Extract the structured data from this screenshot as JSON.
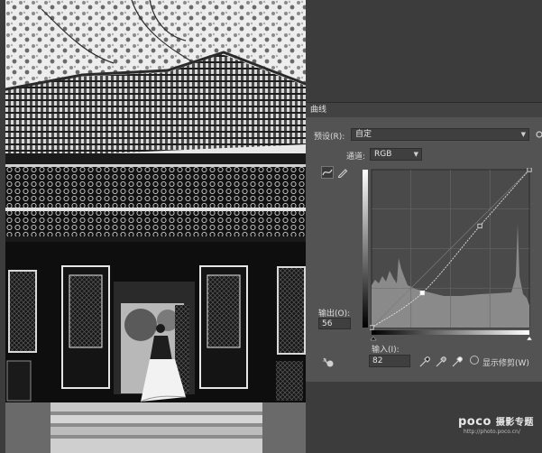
{
  "dialog": {
    "title": "曲线",
    "preset_label": "预设(R):",
    "preset_value": "自定",
    "channel_label": "通道:",
    "channel_value": "RGB",
    "output_label": "输出(O):",
    "output_value": "56",
    "input_label": "输入(I):",
    "input_value": "82",
    "show_clipping_label": "显示修剪(W)",
    "show_clipping_checked": false
  },
  "curve": {
    "points": [
      [
        0,
        0
      ],
      [
        82,
        56
      ],
      [
        175,
        164
      ],
      [
        255,
        255
      ]
    ]
  },
  "icons": [
    "curve-tool-icon",
    "pencil-tool-icon",
    "target-adjust-icon",
    "black-eyedropper-icon",
    "gray-eyedropper-icon",
    "white-eyedropper-icon",
    "settings-icon"
  ],
  "watermark": {
    "brand": "poco",
    "brand_suffix": "摄影专题",
    "url": "http://photo.poco.cn/"
  }
}
